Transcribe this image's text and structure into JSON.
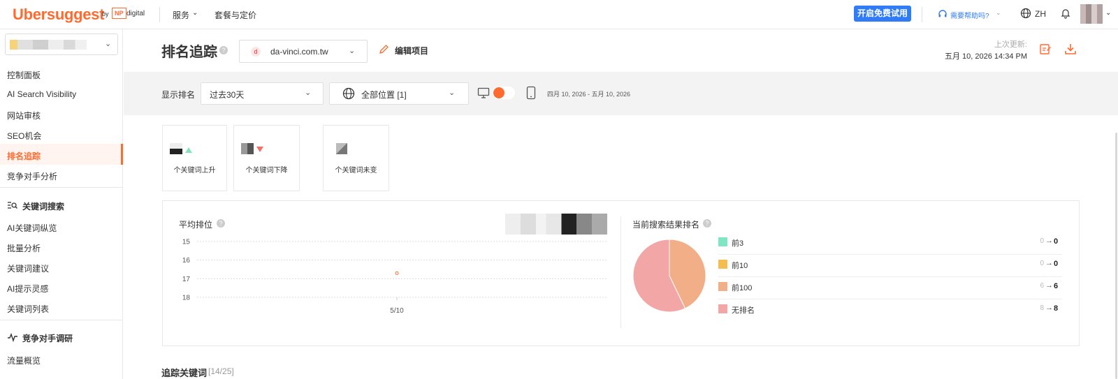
{
  "header": {
    "logo": "Ubersuggest",
    "by": "by",
    "np": "NP",
    "digital": "digital",
    "nav_services": "服务",
    "nav_pricing": "套餐与定价",
    "trial_button": "开启免费试用",
    "help": "需要帮助吗?",
    "language": "ZH",
    "accent_color": "#ff6a2f",
    "primary_color": "#2f7cf6"
  },
  "sidebar": {
    "items": [
      {
        "label": "控制面板"
      },
      {
        "label": "AI Search Visibility"
      },
      {
        "label": "网站审核"
      },
      {
        "label": "SEO机会"
      },
      {
        "label": "排名追踪",
        "active": true
      },
      {
        "label": "竞争对手分析"
      }
    ],
    "keyword_section": {
      "heading": "关键词搜索",
      "items": [
        {
          "label": "AI关键词纵览"
        },
        {
          "label": "批量分析"
        },
        {
          "label": "关键词建议"
        },
        {
          "label": "AI提示灵感"
        },
        {
          "label": "关键词列表"
        }
      ]
    },
    "competitor_section": {
      "heading": "竞争对手调研",
      "items": [
        {
          "label": "流量概览"
        }
      ]
    }
  },
  "main": {
    "title": "排名追踪",
    "domain": "da-vinci.com.tw",
    "domain_favicon": "d",
    "edit_project": "编辑项目",
    "last_update_label": "上次更新:",
    "last_update_value": "五月 10, 2026 14:34 PM"
  },
  "filters": {
    "show_rank_label": "显示排名",
    "period": "过去30天",
    "location": "全部位置 [1]",
    "date_range": "四月 10, 2026 - 五月 10, 2026"
  },
  "stats": [
    {
      "label": "个关键词上升",
      "direction": "up"
    },
    {
      "label": "个关键词下降",
      "direction": "down"
    },
    {
      "label": "个关键词未变",
      "direction": "none"
    }
  ],
  "avg_rank": {
    "title": "平均排位",
    "chart_data": {
      "type": "line",
      "x": [
        "5/10"
      ],
      "series": [
        {
          "values": [
            16.7
          ]
        }
      ],
      "ylim": [
        15,
        18
      ],
      "y_inverted": true,
      "yticks": [
        15,
        16,
        17,
        18
      ],
      "grid": true
    }
  },
  "serp": {
    "title": "当前搜索结果排名",
    "chart_data": {
      "type": "pie",
      "categories": [
        "前3",
        "前10",
        "前100",
        "无排名"
      ],
      "values": [
        0,
        0,
        6,
        8
      ],
      "colors": [
        "#7ee6c2",
        "#f5bd4f",
        "#f2ae86",
        "#f2a6a6"
      ]
    },
    "rows": [
      {
        "label": "前3",
        "from": "0",
        "to": "0",
        "color": "#7ee6c2"
      },
      {
        "label": "前10",
        "from": "0",
        "to": "0",
        "color": "#f5bd4f"
      },
      {
        "label": "前100",
        "from": "6",
        "to": "6",
        "color": "#f2ae86"
      },
      {
        "label": "无排名",
        "from": "8",
        "to": "8",
        "color": "#f2a6a6"
      }
    ],
    "arrow": "→"
  },
  "tracked": {
    "title": "追踪关键词",
    "count": "[14/25]"
  },
  "icons": {
    "dropdown": "⌄",
    "help": "?"
  }
}
